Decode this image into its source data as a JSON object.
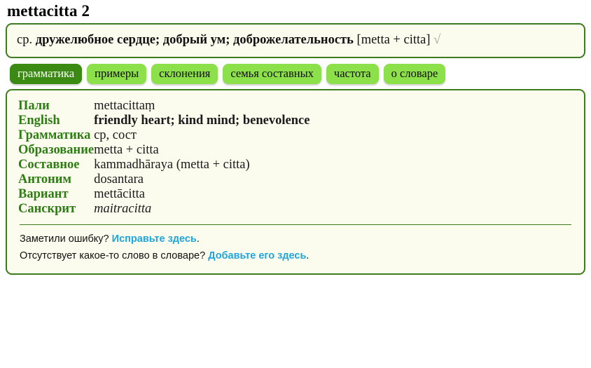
{
  "page": {
    "title": "mettacitta 2"
  },
  "summary": {
    "prefix": "ср. ",
    "definition": "дружелюбное сердце; добрый ум; доброжелательность",
    "construction": " [metta + citta] ",
    "radical": "√"
  },
  "tabs": [
    {
      "label": "грамматика",
      "active": true
    },
    {
      "label": "примеры",
      "active": false
    },
    {
      "label": "склонения",
      "active": false
    },
    {
      "label": "семья составных",
      "active": false
    },
    {
      "label": "частота",
      "active": false
    },
    {
      "label": "о словаре",
      "active": false
    }
  ],
  "detail": {
    "rows": [
      {
        "label": "Пали",
        "value": "mettacittaṃ",
        "style": "normal"
      },
      {
        "label": "English",
        "value": "friendly heart; kind mind; benevolence",
        "style": "bold"
      },
      {
        "label": "Грамматика",
        "value": "ср, сост",
        "style": "normal"
      },
      {
        "label": "Образование",
        "value": "metta + citta",
        "style": "normal"
      },
      {
        "label": "Составное",
        "value": "kammadhāraya (metta + citta)",
        "style": "normal"
      },
      {
        "label": "Антоним",
        "value": "dosantara",
        "style": "normal"
      },
      {
        "label": "Вариант",
        "value": "mettācitta",
        "style": "normal"
      },
      {
        "label": "Санскрит",
        "value": "maitracitta",
        "style": "italic"
      }
    ]
  },
  "footer": {
    "line1_text": "Заметили ошибку? ",
    "line1_link": "Исправьте здесь",
    "line1_end": ".",
    "line2_text": "Отсутствует какое-то слово в словаре? ",
    "line2_link": "Добавьте его здесь",
    "line2_end": "."
  },
  "colors": {
    "border_green": "#3d7c1c",
    "label_green": "#2e7d14",
    "tab_active_bg": "#3a8a13",
    "tab_bg": "#8ce04a",
    "link_blue": "#1fa5dd",
    "panel_bg": "#fbfbee"
  }
}
